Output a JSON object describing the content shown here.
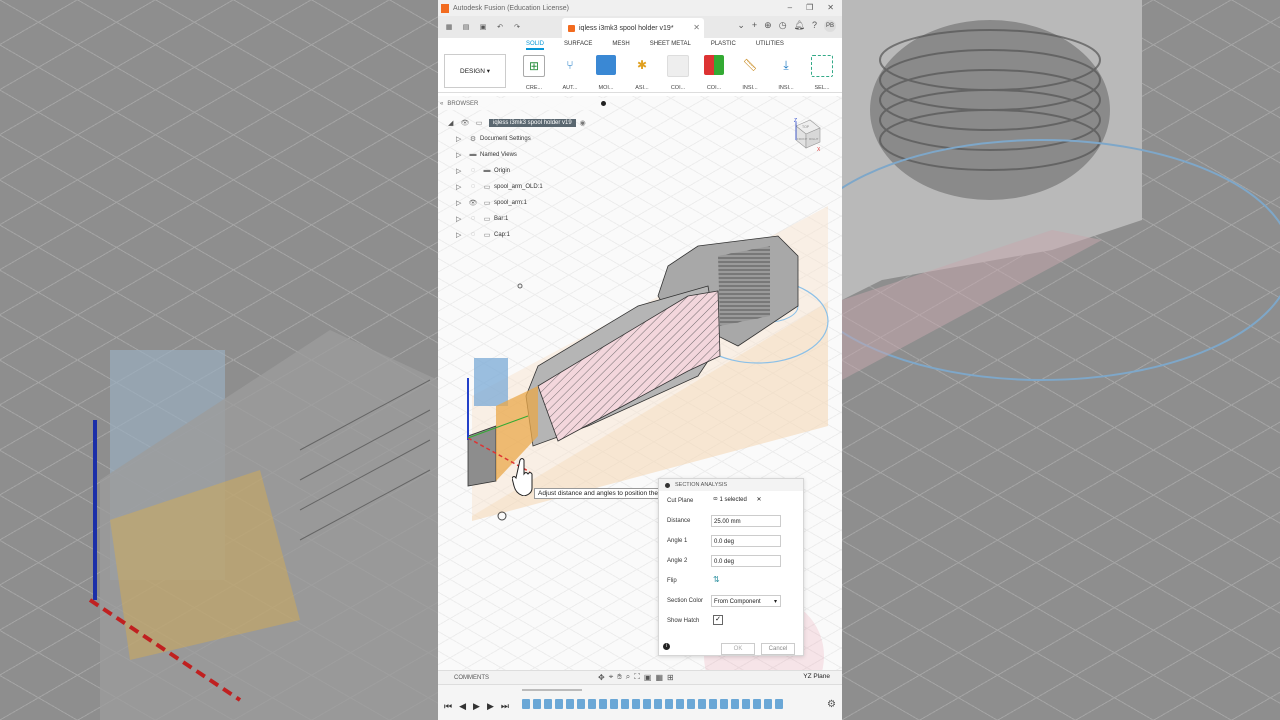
{
  "window": {
    "title": "Autodesk Fusion (Education License)"
  },
  "document_tab": {
    "label": "iqless i3mk3 spool holder v19*"
  },
  "user": {
    "initials": "PB"
  },
  "ribbon": {
    "tabs": [
      "SOLID",
      "SURFACE",
      "MESH",
      "SHEET METAL",
      "PLASTIC",
      "UTILITIES"
    ],
    "active_tab": "SOLID",
    "workspace": "DESIGN",
    "groups": [
      "CRE...",
      "AUT...",
      "MOI...",
      "ASI...",
      "COI...",
      "COI...",
      "INSI...",
      "INSI...",
      "SEL..."
    ]
  },
  "browser": {
    "title": "BROWSER",
    "root": "iqless i3mk3 spool holder v19",
    "items": [
      "Document Settings",
      "Named Views",
      "Origin",
      "spool_arm_OLD:1",
      "spool_arm:1",
      "Bar:1",
      "Cap:1"
    ]
  },
  "tooltip": "Adjust distance and angles to position the cut plane",
  "section_analysis": {
    "title": "SECTION ANALYSIS",
    "cut_plane_label": "Cut Plane",
    "cut_plane_value": "1 selected",
    "distance_label": "Distance",
    "distance_value": "25.00 mm",
    "angle1_label": "Angle 1",
    "angle1_value": "0.0 deg",
    "angle2_label": "Angle 2",
    "angle2_value": "0.0 deg",
    "flip_label": "Flip",
    "section_color_label": "Section Color",
    "section_color_value": "From Component",
    "show_hatch_label": "Show Hatch",
    "show_hatch": true,
    "ok": "OK",
    "cancel": "Cancel"
  },
  "bottom": {
    "comments": "COMMENTS",
    "plane": "YZ Plane"
  },
  "viewcube": {
    "top": "TOP",
    "front": "FRONT",
    "right": "RIGHT",
    "z": "Z",
    "x": "X"
  }
}
